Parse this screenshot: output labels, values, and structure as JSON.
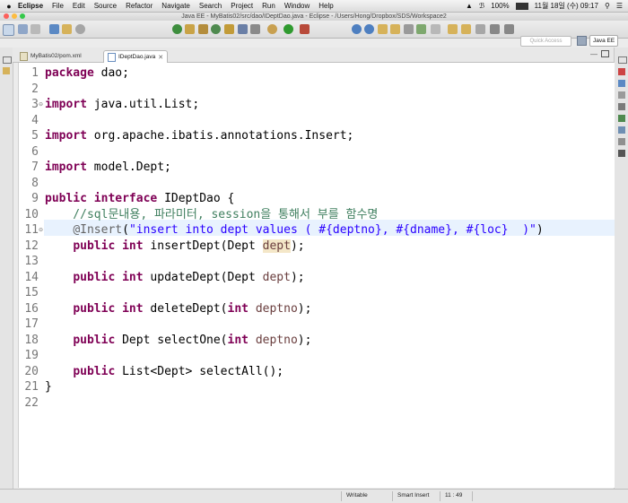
{
  "menubar": {
    "apple": "",
    "app": "Eclipse",
    "items": [
      "File",
      "Edit",
      "Source",
      "Refactor",
      "Navigate",
      "Search",
      "Project",
      "Run",
      "Window",
      "Help"
    ],
    "battery": "100%",
    "clock": "11월 18일 (수)  09:17"
  },
  "window": {
    "title": "Java EE - MyBatis02/src/dao/IDeptDao.java - Eclipse - /Users/Hong/Dropbox/SDS/Workspace2"
  },
  "toolbar": {
    "quick_access": "Quick Access",
    "perspective": "Java EE"
  },
  "tabs": [
    {
      "label": "MyBatis02/pom.xml"
    },
    {
      "label": "IDeptDao.java"
    }
  ],
  "editor": {
    "line_numbers": [
      "1",
      "2",
      "3",
      "4",
      "5",
      "6",
      "7",
      "8",
      "9",
      "10",
      "11",
      "12",
      "13",
      "14",
      "15",
      "16",
      "17",
      "18",
      "19",
      "20",
      "21",
      "22"
    ]
  },
  "status": {
    "mode": "Writable",
    "insert": "Smart Insert",
    "position": "11 : 49"
  }
}
